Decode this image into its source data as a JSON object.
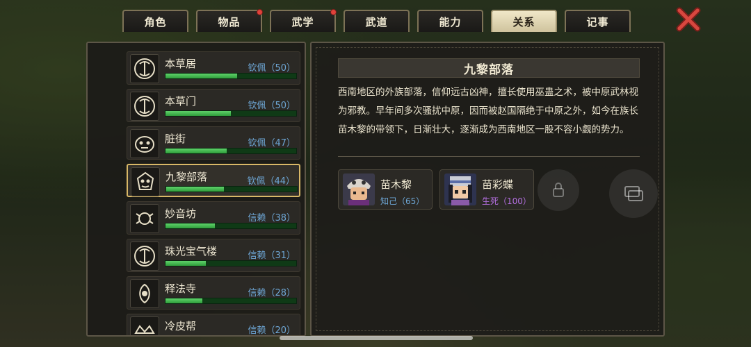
{
  "tabs": [
    {
      "label": "角色",
      "active": false,
      "badge": false
    },
    {
      "label": "物品",
      "active": false,
      "badge": true
    },
    {
      "label": "武学",
      "active": false,
      "badge": true
    },
    {
      "label": "武道",
      "active": false,
      "badge": false
    },
    {
      "label": "能力",
      "active": false,
      "badge": false
    },
    {
      "label": "关系",
      "active": true,
      "badge": false
    },
    {
      "label": "记事",
      "active": false,
      "badge": false
    }
  ],
  "factions": [
    {
      "name": "本草居",
      "status": "钦佩（50）",
      "progress": 0.55,
      "selected": false
    },
    {
      "name": "本草门",
      "status": "钦佩（50）",
      "progress": 0.5,
      "selected": false
    },
    {
      "name": "脏街",
      "status": "钦佩（47）",
      "progress": 0.47,
      "selected": false
    },
    {
      "name": "九黎部落",
      "status": "钦佩（44）",
      "progress": 0.44,
      "selected": true
    },
    {
      "name": "妙音坊",
      "status": "信赖（38）",
      "progress": 0.38,
      "selected": false
    },
    {
      "name": "珠光宝气楼",
      "status": "信赖（31）",
      "progress": 0.31,
      "selected": false
    },
    {
      "name": "释法寺",
      "status": "信赖（28）",
      "progress": 0.28,
      "selected": false
    },
    {
      "name": "冷皮帮",
      "status": "信赖（20）",
      "progress": 0.2,
      "selected": false
    }
  ],
  "detail": {
    "title": "九黎部落",
    "description": "西南地区的外族部落，信仰远古凶神，擅长使用巫蛊之术，被中原武林视为邪教。早年间多次骚扰中原，因而被赵国隔绝于中原之外，如今在族长苗木黎的带领下，日渐壮大，逐渐成为西南地区一股不容小觑的势力。",
    "members": [
      {
        "name": "苗木黎",
        "relation": "知己（65）",
        "relation_color": "#6ea7d6"
      },
      {
        "name": "苗彩蝶",
        "relation": "生死（100）",
        "relation_color": "#b46fe0"
      }
    ]
  },
  "colors": {
    "accent_gold": "#d9b867",
    "bar_green": "#3fb34c",
    "status_blue": "#6ea7d6",
    "close_red": "#d8473f"
  },
  "icons": {
    "close": "close-x-icon",
    "faction_emblem": "faction-emblem-icon"
  }
}
